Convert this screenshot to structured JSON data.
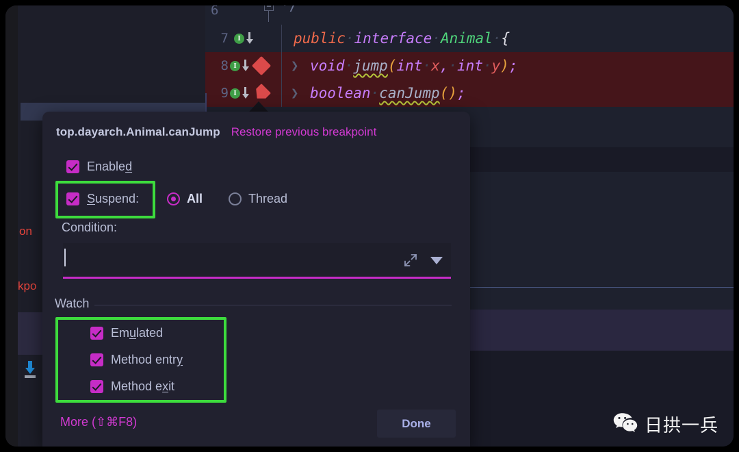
{
  "window": {
    "app": "IntelliJ IDEA",
    "theme_bg": "#1b1b24"
  },
  "editor": {
    "language": "Java",
    "lines": [
      {
        "number": "6",
        "fold_glyph": "−",
        "text": "*/",
        "gutter": []
      },
      {
        "number": "7",
        "text": "public interface Animal {",
        "gutter": [
          "implemented-icon",
          "arrow-down-icon"
        ],
        "highlighted": false
      },
      {
        "number": "8",
        "text": "void jump(int x, int y);",
        "gutter": [
          "implemented-icon",
          "arrow-down-icon",
          "breakpoint-diamond"
        ],
        "highlighted": true,
        "fold_caret": "❯"
      },
      {
        "number": "9",
        "text": "boolean canJump();",
        "gutter": [
          "implemented-icon",
          "arrow-down-icon",
          "breakpoint-diamond"
        ],
        "highlighted": true,
        "fold_caret": "❯"
      }
    ],
    "tokens": {
      "l7": [
        "public",
        "interface",
        "Animal",
        "{"
      ],
      "l8": [
        "void",
        "jump",
        "(",
        "int",
        "x",
        ",",
        "int",
        "y",
        ")",
        ";"
      ],
      "l9": [
        "boolean",
        "canJump",
        "(",
        ")",
        ";"
      ]
    }
  },
  "left_panel": {
    "fragment_top": "on",
    "fragment_bottom": "kpo",
    "download_icon": "download-icon"
  },
  "dialog": {
    "title": "top.dayarch.Animal.canJump",
    "restore_link": "Restore previous breakpoint",
    "enabled": {
      "label": "Enabled",
      "label_pre": "Enable",
      "label_mnemonic": "d",
      "checked": true
    },
    "suspend": {
      "label": "Suspend:",
      "label_mnemonic": "S",
      "label_rest": "uspend:",
      "checked": true,
      "options": [
        {
          "label": "All",
          "selected": true
        },
        {
          "label": "Thread",
          "selected": false
        }
      ]
    },
    "condition": {
      "label": "Condition:",
      "value": "",
      "placeholder": "",
      "expand_icon": "expand-icon",
      "dropdown_icon": "chevron-down-icon"
    },
    "watch": {
      "group_label": "Watch",
      "items": [
        {
          "label_pre": "Em",
          "label_mnemonic": "u",
          "label_post": "lated",
          "label": "Emulated",
          "checked": true
        },
        {
          "label_pre": "Method entr",
          "label_mnemonic": "y",
          "label_post": "",
          "label": "Method entry",
          "checked": true
        },
        {
          "label_pre": "Method e",
          "label_mnemonic": "x",
          "label_post": "it",
          "label": "Method exit",
          "checked": true
        }
      ]
    },
    "footer": {
      "more_label": "More (⇧⌘F8)",
      "done_label": "Done"
    }
  },
  "annotations": {
    "highlight_color": "#3ddc3d",
    "boxes": [
      {
        "name": "suspend-highlight"
      },
      {
        "name": "watch-items-highlight"
      }
    ]
  },
  "watermark": {
    "icon": "wechat-icon",
    "text": "日拱一兵"
  },
  "colors": {
    "accent_magenta": "#c62cc6",
    "link_magenta": "#d23ad2",
    "highlight_green": "#3ddc3d",
    "breakpoint_red": "#db4a4a",
    "dialog_bg": "#21212f",
    "editor_bg": "#1e212e",
    "code_highlight_bg": "#45151a"
  }
}
